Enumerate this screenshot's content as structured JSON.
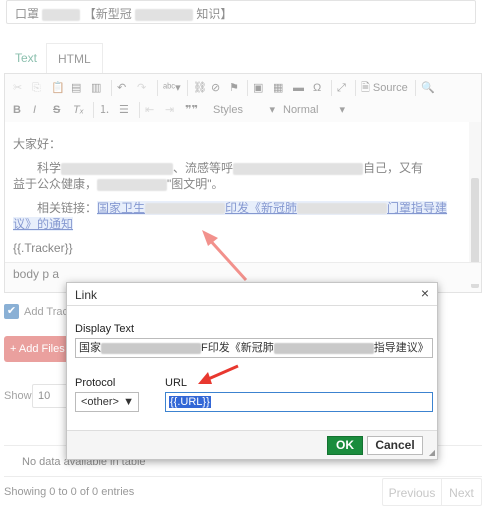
{
  "form": {
    "title_prefix": "口罩",
    "title_mid": "【新型冠",
    "title_suffix": "知识】"
  },
  "tabs": [
    {
      "label": "Text"
    },
    {
      "label": "HTML"
    }
  ],
  "toolbar": {
    "source_label": "Source",
    "styles_label": "Styles",
    "format_label": "Normal"
  },
  "editor": {
    "greeting": "大家好：",
    "para1_a": "科学",
    "para1_b": "、流感等呼",
    "para1_c": "自己，又有",
    "para1_d": "益于公众健康，",
    "para1_e": "\"图文明\"。",
    "link_prefix": "相关链接：",
    "link_a": "国家卫生",
    "link_b": "印发《新冠肺",
    "link_c": "门罩指导建",
    "link_d": "议》的通知",
    "tracker": "{{.Tracker}}",
    "path": "body  p  a"
  },
  "page": {
    "add_tracking_label": "Add Track",
    "add_files_label": "+ Add Files",
    "show_label": "Show",
    "show_value": "10",
    "no_data": "No data available in table",
    "showing": "Showing 0 to 0 of 0 entries",
    "prev_label": "Previous",
    "next_label": "Next"
  },
  "dialog": {
    "title": "Link",
    "close_symbol": "×",
    "display_text_label": "Display Text",
    "display_text_a": "国家",
    "display_text_b": "F印发《新冠肺",
    "display_text_c": "指导建议》",
    "protocol_label": "Protocol",
    "protocol_value": "<other>",
    "url_label": "URL",
    "url_value": "{{.URL}}",
    "ok_label": "OK",
    "cancel_label": "Cancel"
  },
  "colors": {
    "accent_green": "#1a8c3d",
    "annotation_red": "#e8382f",
    "add_files_red": "#d9534f",
    "selection_blue": "#3367d6"
  }
}
